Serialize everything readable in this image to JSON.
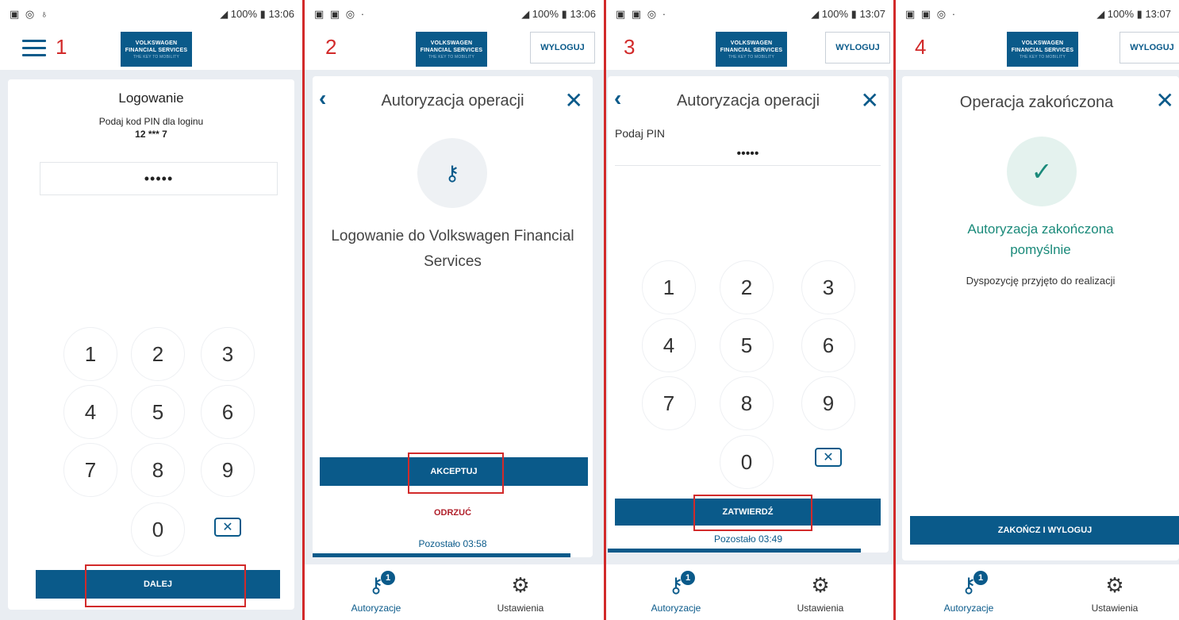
{
  "colors": {
    "brand": "#0a5a8a",
    "annotation_red": "#d22a2a",
    "success_green": "#1a8a7a"
  },
  "logo": {
    "line1": "VOLKSWAGEN",
    "line2": "FINANCIAL SERVICES",
    "tagline": "THE KEY TO MOBILITY"
  },
  "keypad": [
    "1",
    "2",
    "3",
    "4",
    "5",
    "6",
    "7",
    "8",
    "9",
    "0"
  ],
  "screen1": {
    "step": "1",
    "status_time": "13:06",
    "status_battery": "100%",
    "title": "Logowanie",
    "subtitle": "Podaj kod PIN dla loginu",
    "login_masked": "12 *** 7",
    "pin_dots": "•••••",
    "next_button": "DALEJ"
  },
  "screen2": {
    "step": "2",
    "status_time": "13:06",
    "status_battery": "100%",
    "logout": "WYLOGUJ",
    "header_title": "Autoryzacja operacji",
    "message": "Logowanie do Volkswagen Financial Services",
    "accept_button": "AKCEPTUJ",
    "reject_button": "ODRZUĆ",
    "remaining": "Pozostało 03:58",
    "progress_fraction": 0.92
  },
  "screen3": {
    "step": "3",
    "status_time": "13:07",
    "status_battery": "100%",
    "logout": "WYLOGUJ",
    "header_title": "Autoryzacja operacji",
    "pin_label": "Podaj PIN",
    "pin_dots": "•••••",
    "confirm_button": "ZATWIERDŹ",
    "remaining": "Pozostało 03:49",
    "progress_fraction": 0.9
  },
  "screen4": {
    "step": "4",
    "status_time": "13:07",
    "status_battery": "100%",
    "logout": "WYLOGUJ",
    "header_title": "Operacja zakończona",
    "success_line1": "Autoryzacja zakończona",
    "success_line2": "pomyślnie",
    "info": "Dyspozycję przyjęto do realizacji",
    "finish_button": "ZAKOŃCZ I WYLOGUJ"
  },
  "bottom_nav": {
    "authorizations": "Autoryzacje",
    "settings": "Ustawienia",
    "badge_count": "1"
  }
}
